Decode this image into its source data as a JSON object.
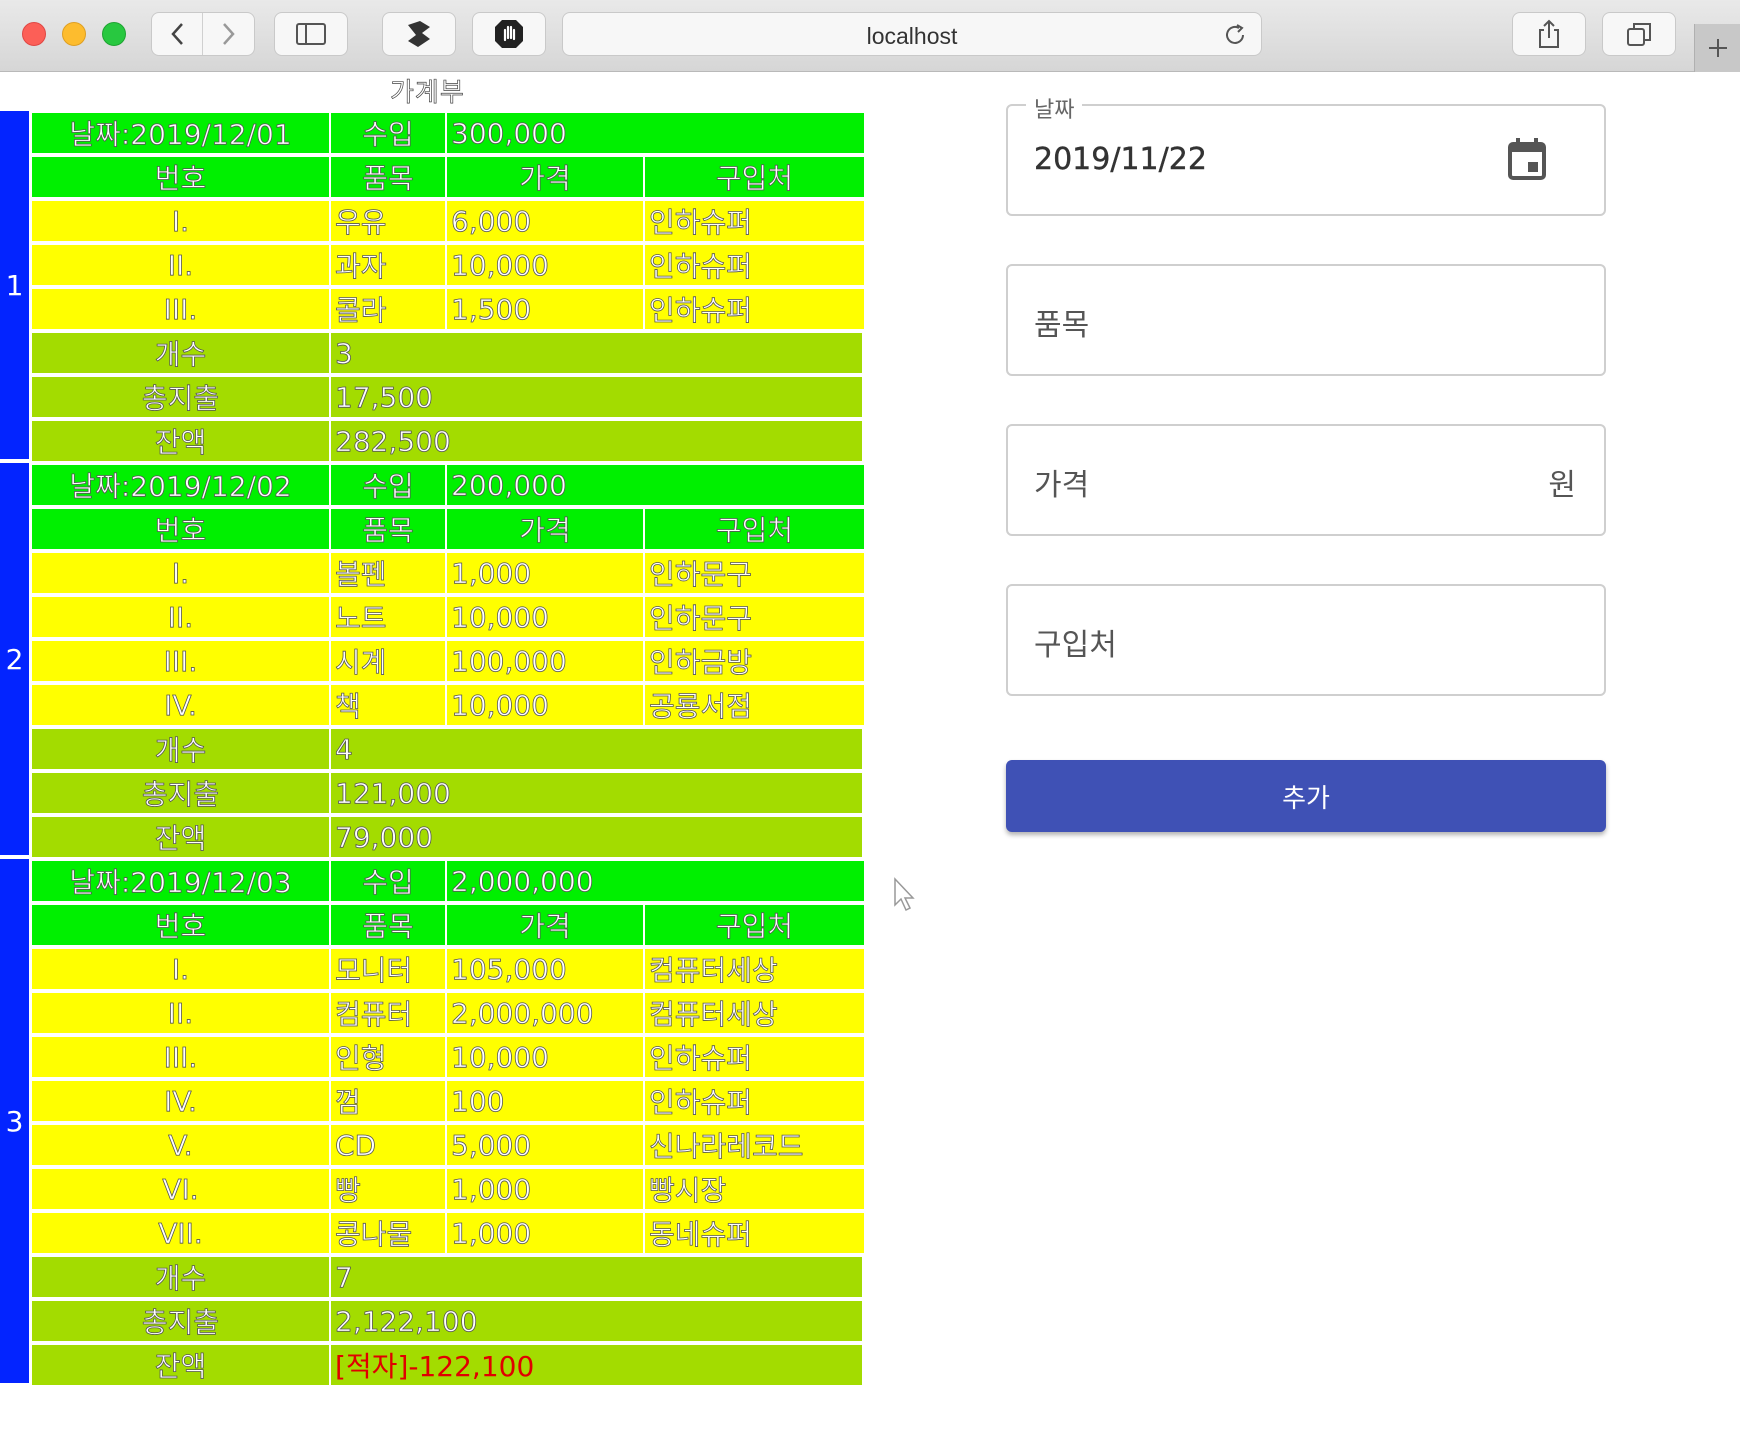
{
  "browser": {
    "url": "localhost"
  },
  "ledger": {
    "title": "가계부",
    "labels": {
      "number": "번호",
      "item": "품목",
      "price": "가격",
      "store": "구입처",
      "income": "수입",
      "count": "개수",
      "total": "총지출",
      "balance": "잔액"
    },
    "entries": [
      {
        "index": "1",
        "date": "날짜:2019/12/01",
        "income": "300,000",
        "items": [
          {
            "no": "I.",
            "item": "우유",
            "price": "6,000",
            "store": "인하슈퍼"
          },
          {
            "no": "II.",
            "item": "과자",
            "price": "10,000",
            "store": "인하슈퍼"
          },
          {
            "no": "III.",
            "item": "콜라",
            "price": "1,500",
            "store": "인하슈퍼"
          }
        ],
        "count": "3",
        "total": "17,500",
        "balance": "282,500"
      },
      {
        "index": "2",
        "date": "날짜:2019/12/02",
        "income": "200,000",
        "items": [
          {
            "no": "I.",
            "item": "볼펜",
            "price": "1,000",
            "store": "인하문구"
          },
          {
            "no": "II.",
            "item": "노트",
            "price": "10,000",
            "store": "인하문구"
          },
          {
            "no": "III.",
            "item": "시계",
            "price": "100,000",
            "store": "인하금방"
          },
          {
            "no": "IV.",
            "item": "책",
            "price": "10,000",
            "store": "공룡서점"
          }
        ],
        "count": "4",
        "total": "121,000",
        "balance": "79,000"
      },
      {
        "index": "3",
        "date": "날짜:2019/12/03",
        "income": "2,000,000",
        "items": [
          {
            "no": "I.",
            "item": "모니터",
            "price": "105,000",
            "store": "컴퓨터세상"
          },
          {
            "no": "II.",
            "item": "컴퓨터",
            "price": "2,000,000",
            "store": "컴퓨터세상"
          },
          {
            "no": "III.",
            "item": "인형",
            "price": "10,000",
            "store": "인하슈퍼"
          },
          {
            "no": "IV.",
            "item": "껌",
            "price": "100",
            "store": "인하슈퍼"
          },
          {
            "no": "V.",
            "item": "CD",
            "price": "5,000",
            "store": "신나라레코드"
          },
          {
            "no": "VI.",
            "item": "빵",
            "price": "1,000",
            "store": "빵시장"
          },
          {
            "no": "VII.",
            "item": "콩나물",
            "price": "1,000",
            "store": "동네슈퍼"
          }
        ],
        "count": "7",
        "total": "2,122,100",
        "balance": "[적자]-122,100",
        "deficit": true
      }
    ]
  },
  "form": {
    "date_label": "날짜",
    "date_value": "2019/11/22",
    "item_placeholder": "품목",
    "price_placeholder": "가격",
    "price_suffix": "원",
    "store_placeholder": "구입처",
    "add_button": "추가"
  },
  "colors": {
    "index_blue": "#0324ff",
    "header_green": "#00f000",
    "item_yellow": "#ffff00",
    "summary_olive": "#a3dc00",
    "deficit_red": "#e00000",
    "button_indigo": "#3f51b5"
  }
}
